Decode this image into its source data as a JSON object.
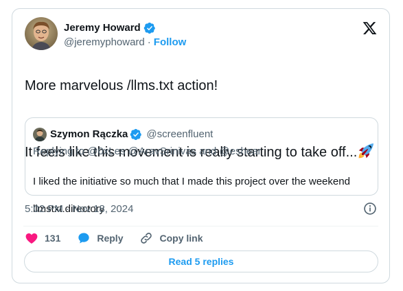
{
  "colors": {
    "accent": "#1d9bf0",
    "heart": "#f91880",
    "text_primary": "#0f1419",
    "text_secondary": "#536471",
    "border": "#cfd9de"
  },
  "tweet": {
    "author": {
      "name": "Jeremy Howard",
      "handle": "@jeremyphoward",
      "verified_icon": "verified-badge-icon",
      "separator": "·",
      "follow_label": "Follow"
    },
    "x_logo_icon": "x-logo-icon",
    "text_line1": "More marvelous /llms.txt action!",
    "text_line2": "It feels like this movement is really starting to take off...",
    "emoji": "rocket-emoji",
    "quote": {
      "author_name": "Szymon Rączka",
      "author_handle": "@screenfluent",
      "reply_to": "Replying to @0xLes @AravSrinivas and @eshear",
      "text_line1": "I liked the initiative so much that I made this project over the weekend",
      "text_line2": "llmstxt.directory"
    },
    "timestamp": "5:02 PM · Nov 18, 2024",
    "info_icon": "info-icon",
    "actions": {
      "like_count": "131",
      "reply_label": "Reply",
      "copy_link_label": "Copy link"
    },
    "read_replies_label": "Read 5 replies"
  }
}
